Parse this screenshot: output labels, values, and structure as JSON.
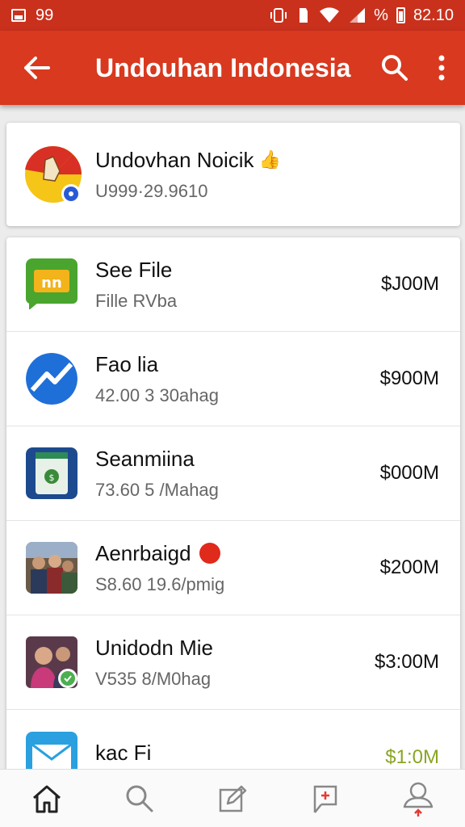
{
  "status_bar": {
    "time": "82.10",
    "notification_count": "99",
    "battery_label": "%"
  },
  "app_bar": {
    "title": "Undouhan Indonesia",
    "icons": [
      "back-arrow-icon",
      "search-icon",
      "more-vert-icon"
    ]
  },
  "header": {
    "name": "Undovhan Noicik",
    "subtitle": "U999·29.9610",
    "emoji": "👍"
  },
  "apps": [
    {
      "name": "See File",
      "meta": "Fille RVba",
      "price": "$J00M",
      "icon": "chat-bubble-icon"
    },
    {
      "name": "Fao lia",
      "meta": "42.00 3 30ahag",
      "price": "$900M",
      "icon": "trending-chart-icon"
    },
    {
      "name": "Seanmiina",
      "meta": "73.60 5 /Mahag",
      "price": "$000M",
      "icon": "phone-app-icon"
    },
    {
      "name": "Aenrbaigd",
      "meta": "S8.60 19.6/pmig",
      "price": "$200M",
      "icon": "photo-people-icon"
    },
    {
      "name": "Unidodn Mie",
      "meta": "V535 8/M0hag",
      "price": "$3:00M",
      "icon": "photo-person-icon"
    },
    {
      "name": "kac Fi",
      "meta": "",
      "price": "$1:0M",
      "icon": "mail-icon"
    }
  ],
  "colors": {
    "accent": "#d8391f",
    "status": "#c9311d",
    "price_highlight": "#8aa524"
  },
  "bottom_nav": [
    "home-icon",
    "search-icon",
    "edit-icon",
    "flag-icon",
    "profile-icon"
  ]
}
